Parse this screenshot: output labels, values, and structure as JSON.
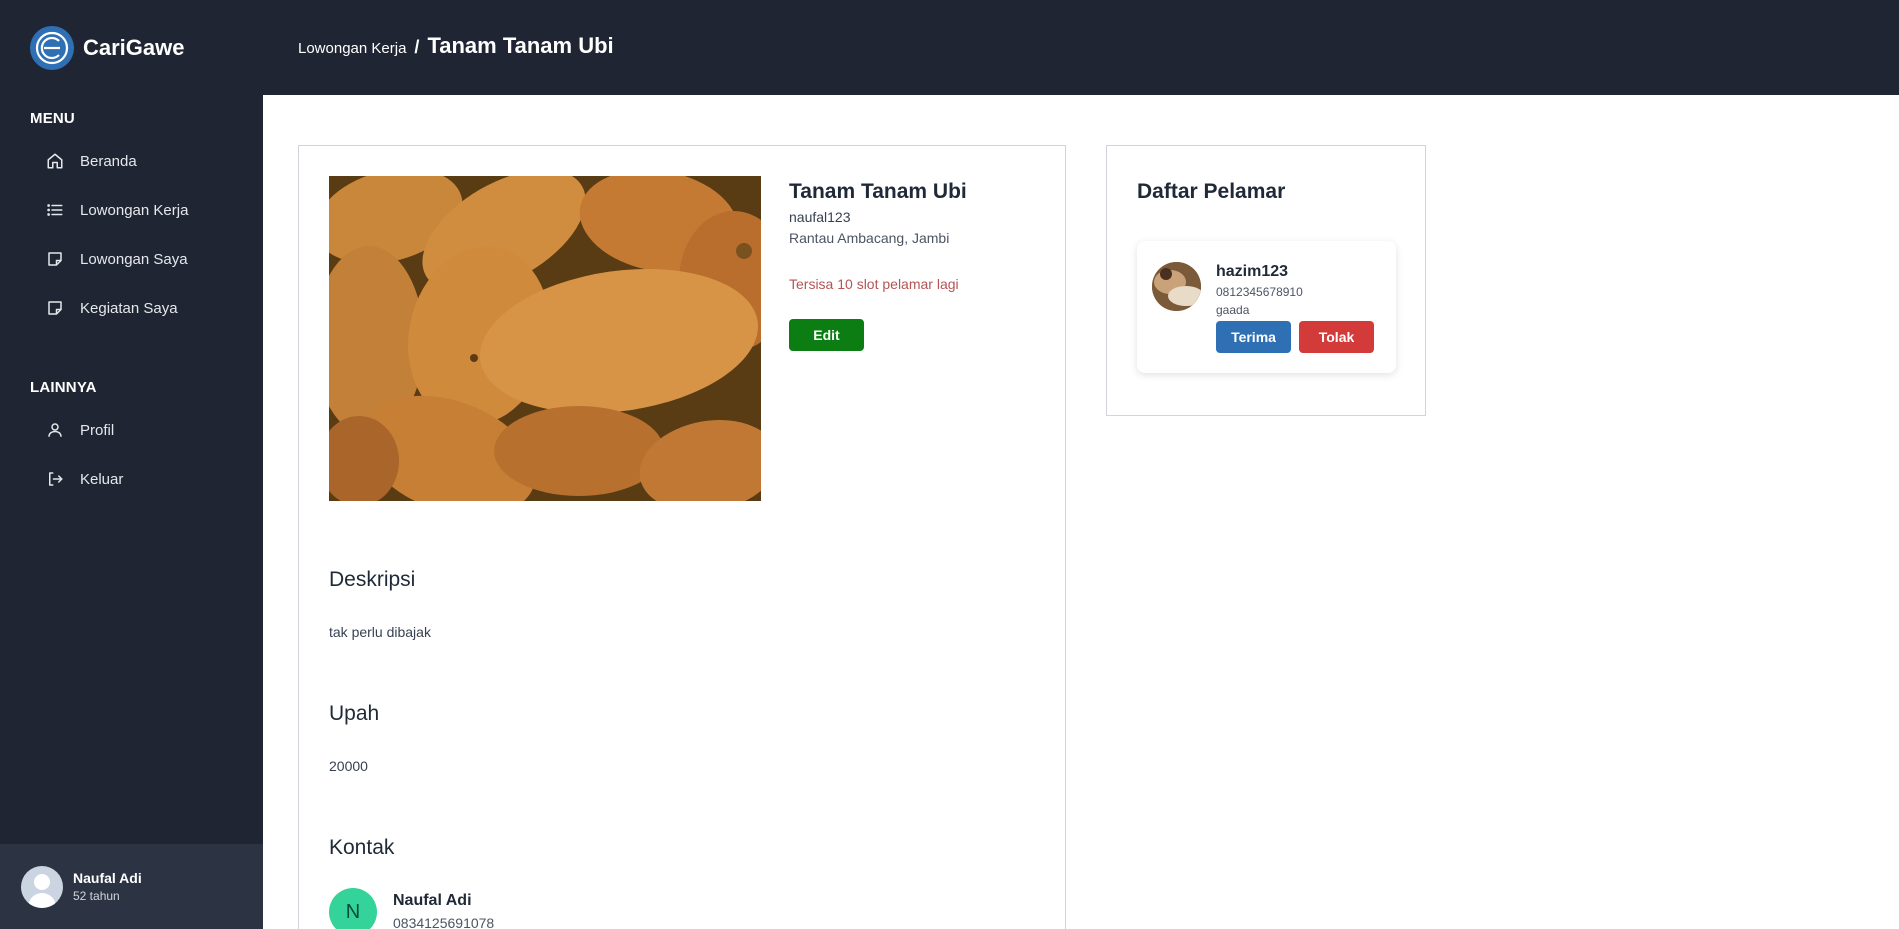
{
  "app": {
    "name": "CariGawe"
  },
  "sidebar": {
    "menu_title": "MENU",
    "menu_items": [
      {
        "label": "Beranda",
        "icon": "home-icon"
      },
      {
        "label": "Lowongan Kerja",
        "icon": "list-icon"
      },
      {
        "label": "Lowongan Saya",
        "icon": "note-icon"
      },
      {
        "label": "Kegiatan Saya",
        "icon": "note-icon"
      }
    ],
    "other_title": "LAINNYA",
    "other_items": [
      {
        "label": "Profil",
        "icon": "user-icon"
      },
      {
        "label": "Keluar",
        "icon": "logout-icon"
      }
    ],
    "user": {
      "name": "Naufal Adi",
      "age": "52 tahun"
    }
  },
  "breadcrumb": {
    "parent": "Lowongan Kerja",
    "separator": "/",
    "current": "Tanam Tanam Ubi"
  },
  "job": {
    "title": "Tanam Tanam Ubi",
    "owner": "naufal123",
    "location": "Rantau Ambacang, Jambi",
    "slots_text": "Tersisa 10 slot pelamar lagi",
    "edit_label": "Edit",
    "description_heading": "Deskripsi",
    "description": "tak perlu dibajak",
    "wage_heading": "Upah",
    "wage": "20000",
    "contact_heading": "Kontak",
    "contact": {
      "initial": "N",
      "name": "Naufal Adi",
      "phone": "0834125691078"
    }
  },
  "applicants": {
    "title": "Daftar Pelamar",
    "list": [
      {
        "username": "hazim123",
        "phone": "0812345678910",
        "note": "gaada",
        "accept_label": "Terima",
        "reject_label": "Tolak"
      }
    ]
  },
  "colors": {
    "sidebar_bg": "#1f2532",
    "accent_blue": "#2f6fb4",
    "edit_green": "#0b7d12",
    "reject_red": "#d33a3a",
    "slots_text": "#b45454",
    "contact_avatar": "#34d399"
  }
}
